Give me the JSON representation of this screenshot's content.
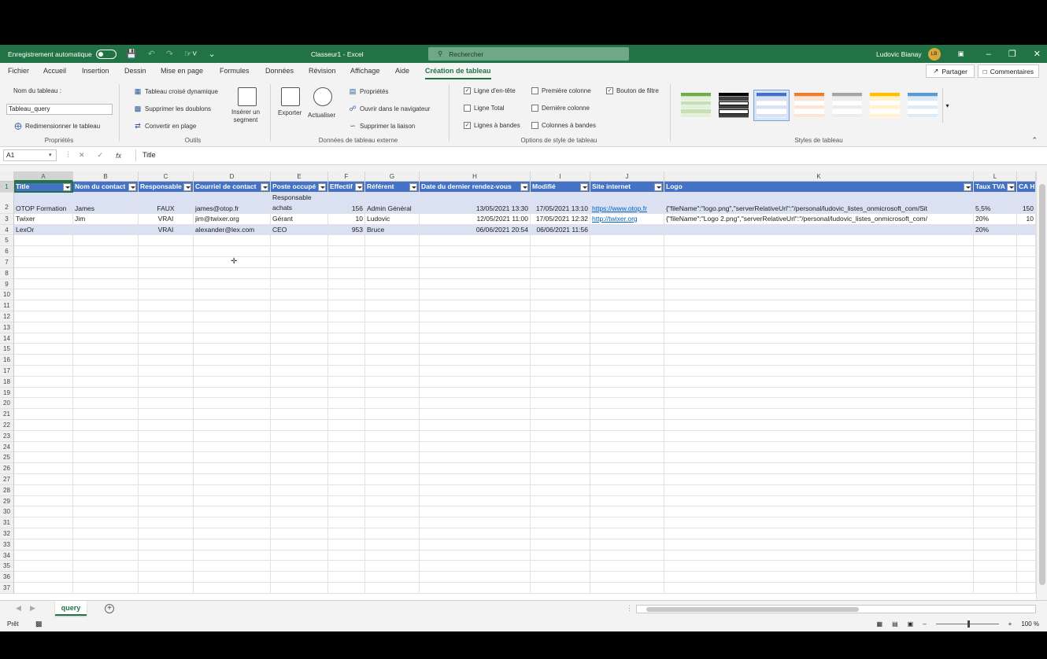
{
  "titlebar": {
    "autosave": "Enregistrement automatique",
    "title": "Classeur1 - Excel",
    "search_placeholder": "Rechercher",
    "user": "Ludovic Bianay",
    "user_initials": "LB"
  },
  "menu": {
    "tabs": [
      "Fichier",
      "Accueil",
      "Insertion",
      "Dessin",
      "Mise en page",
      "Formules",
      "Données",
      "Révision",
      "Affichage",
      "Aide",
      "Création de tableau"
    ],
    "share": "Partager",
    "comments": "Commentaires"
  },
  "ribbon": {
    "props": {
      "name_label": "Nom du tableau :",
      "name_value": "Tableau_query",
      "resize": "Redimensionner le tableau",
      "group": "Propriétés"
    },
    "tools": {
      "pivot": "Tableau croisé dynamique",
      "dedupe": "Supprimer les doublons",
      "convert": "Convertir en plage",
      "slicer_1": "Insérer un",
      "slicer_2": "segment",
      "group": "Outils"
    },
    "external": {
      "export": "Exporter",
      "refresh": "Actualiser",
      "properties": "Propriétés",
      "open_browser": "Ouvrir dans le navigateur",
      "unlink": "Supprimer la liaison",
      "group": "Données de tableau externe"
    },
    "options": {
      "header_row": "Ligne d'en-tête",
      "total_row": "Ligne Total",
      "banded_rows": "Lignes à bandes",
      "first_col": "Première colonne",
      "last_col": "Dernière colonne",
      "banded_cols": "Colonnes à bandes",
      "filter_btn": "Bouton de filtre",
      "group": "Options de style de tableau"
    },
    "styles": {
      "group": "Styles de tableau"
    }
  },
  "formula_bar": {
    "cell_ref": "A1",
    "content": "Title"
  },
  "columns": [
    "A",
    "B",
    "C",
    "D",
    "E",
    "F",
    "G",
    "H",
    "I",
    "J",
    "K",
    "L"
  ],
  "headers": [
    "Title",
    "Nom du contact",
    "Responsable",
    "Courriel de contact",
    "Poste occupé",
    "Effectif",
    "Référent",
    "Date du dernier rendez-vous",
    "Modifié",
    "Site internet",
    "Logo",
    "Taux TVA",
    "CA H"
  ],
  "rows": [
    {
      "title": "OTOP Formation",
      "contact": "James",
      "responsable": "FAUX",
      "email": "james@otop.fr",
      "poste_1": "Responsable",
      "poste_2": "achats",
      "effectif": "156",
      "referent": "Admin Général",
      "date_rdv": "13/05/2021 13:30",
      "modifie": "17/05/2021 13:10",
      "site": "https://www.otop.fr",
      "logo": "{\"fileName\":\"logo.png\",\"serverRelativeUrl\":\"/personal/ludovic_listes_onmicrosoft_com/Sit",
      "tva": "5,5%",
      "ca": "150"
    },
    {
      "title": "Twixer",
      "contact": "Jim",
      "responsable": "VRAI",
      "email": "jim@twixer.org",
      "poste_1": "Gérant",
      "poste_2": "",
      "effectif": "10",
      "referent": "Ludovic",
      "date_rdv": "12/05/2021 11:00",
      "modifie": "17/05/2021 12:32",
      "site": "http://twixer.org",
      "logo": "{\"fileName\":\"Logo 2.png\",\"serverRelativeUrl\":\"/personal/ludovic_listes_onmicrosoft_com/",
      "tva": "20%",
      "ca": "10"
    },
    {
      "title": "LexOr",
      "contact": "",
      "responsable": "VRAI",
      "email": "alexander@lex.com",
      "poste_1": "CEO",
      "poste_2": "",
      "effectif": "953",
      "referent": "Bruce",
      "date_rdv": "06/06/2021 20:54",
      "modifie": "06/06/2021 11:56",
      "site": "",
      "logo": "",
      "tva": "20%",
      "ca": ""
    }
  ],
  "row_numbers": [
    "1",
    "2",
    "3",
    "4",
    "5",
    "6",
    "7",
    "8",
    "9",
    "10",
    "11",
    "12",
    "13",
    "14",
    "15",
    "16",
    "17",
    "18",
    "19",
    "20",
    "21",
    "22",
    "23",
    "24",
    "25",
    "26",
    "27",
    "28",
    "29",
    "30",
    "31",
    "32",
    "33",
    "34",
    "35",
    "36",
    "37"
  ],
  "sheet": {
    "name": "query",
    "status": "Prêt",
    "zoom": "100 %"
  },
  "colors": {
    "accent": "#217346",
    "table_header": "#4472c4",
    "band": "#d9e1f2",
    "link": "#0563c1"
  }
}
